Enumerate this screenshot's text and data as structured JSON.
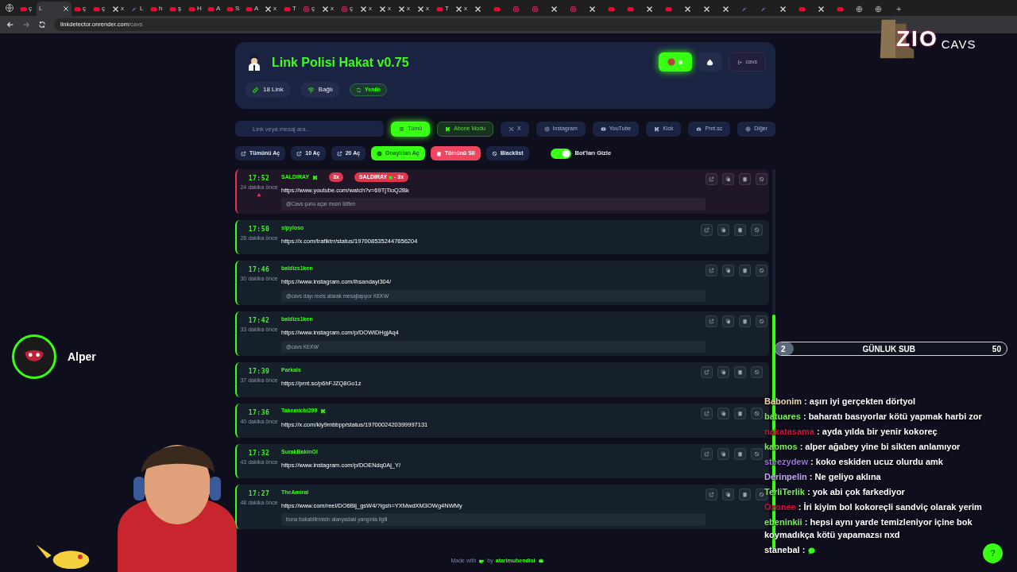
{
  "browser": {
    "tabs": [
      {
        "kind": "youtube",
        "label": "ç",
        "selected": false
      },
      {
        "kind": "plain",
        "label": "L",
        "selected": true
      },
      {
        "kind": "youtube",
        "label": "ç",
        "selected": false
      },
      {
        "kind": "youtube",
        "label": "ç",
        "selected": false
      },
      {
        "kind": "x",
        "label": "x",
        "selected": false
      },
      {
        "kind": "feather",
        "label": "L",
        "selected": false
      },
      {
        "kind": "youtube",
        "label": "h",
        "selected": false
      },
      {
        "kind": "youtube",
        "label": "ş",
        "selected": false
      },
      {
        "kind": "youtube",
        "label": "H",
        "selected": false
      },
      {
        "kind": "youtube",
        "label": "A",
        "selected": false
      },
      {
        "kind": "youtube",
        "label": "S",
        "selected": false
      },
      {
        "kind": "youtube",
        "label": "A",
        "selected": false
      },
      {
        "kind": "x",
        "label": "x",
        "selected": false
      },
      {
        "kind": "youtube",
        "label": "T",
        "selected": false
      },
      {
        "kind": "instagram",
        "label": "ç",
        "selected": false
      },
      {
        "kind": "x",
        "label": "x",
        "selected": false
      },
      {
        "kind": "instagram",
        "label": "ç",
        "selected": false
      },
      {
        "kind": "x",
        "label": "x",
        "selected": false
      },
      {
        "kind": "x",
        "label": "x",
        "selected": false
      },
      {
        "kind": "x",
        "label": "x",
        "selected": false
      },
      {
        "kind": "x",
        "label": "x",
        "selected": false
      },
      {
        "kind": "youtube",
        "label": "T",
        "selected": false
      },
      {
        "kind": "x",
        "label": "x",
        "selected": false
      },
      {
        "kind": "x",
        "selected": false
      },
      {
        "kind": "youtube",
        "selected": false
      },
      {
        "kind": "instagram",
        "selected": false
      },
      {
        "kind": "instagram",
        "selected": false
      },
      {
        "kind": "x",
        "selected": false
      },
      {
        "kind": "instagram",
        "selected": false
      },
      {
        "kind": "x",
        "selected": false
      },
      {
        "kind": "youtube",
        "selected": false
      },
      {
        "kind": "youtube",
        "selected": false
      },
      {
        "kind": "x",
        "selected": false
      },
      {
        "kind": "youtube",
        "selected": false
      },
      {
        "kind": "x",
        "selected": false
      },
      {
        "kind": "x",
        "selected": false
      },
      {
        "kind": "x",
        "selected": false
      },
      {
        "kind": "feather",
        "selected": false
      },
      {
        "kind": "feather",
        "selected": false
      },
      {
        "kind": "x",
        "selected": false
      },
      {
        "kind": "youtube",
        "selected": false
      },
      {
        "kind": "x",
        "selected": false
      },
      {
        "kind": "youtube",
        "selected": false
      },
      {
        "kind": "globe",
        "selected": false
      },
      {
        "kind": "globe",
        "selected": false
      }
    ],
    "new_tab_label": "+",
    "url_host": "linkdetector.onrender.com",
    "url_path": "/cavs"
  },
  "app": {
    "title": "Link Polisi Hakat v0.75",
    "stats": [
      {
        "kind": "link",
        "label": "18 Link"
      },
      {
        "kind": "wifi",
        "label": "Bağlı"
      },
      {
        "kind": "refresh",
        "label": "Yenile"
      }
    ],
    "logout_label": "cavs",
    "search": {
      "placeholder": "Link veya mesaj ara..."
    },
    "filters": [
      {
        "kind": "list",
        "label": "Tümü",
        "selected": true
      },
      {
        "kind": "kick",
        "label": "Abone Modu",
        "selected": false
      },
      {
        "kind": "x",
        "label": "X",
        "selected": false
      },
      {
        "kind": "instagram",
        "label": "Instagram",
        "selected": false
      },
      {
        "kind": "youtube",
        "label": "YouTube",
        "selected": false
      },
      {
        "kind": "kick",
        "label": "Kick",
        "selected": false
      },
      {
        "kind": "camera",
        "label": "Prnt.sc",
        "selected": false
      },
      {
        "kind": "globe",
        "label": "Diğer",
        "selected": false
      }
    ],
    "actions": [
      {
        "kind": "plain",
        "label": "Tümünü Aç"
      },
      {
        "kind": "plain",
        "label": "10 Aç"
      },
      {
        "kind": "plain",
        "label": "20 Aç"
      },
      {
        "kind": "success",
        "label": "Onaylıları Aç"
      },
      {
        "kind": "danger",
        "label": "Tümünü Sil"
      },
      {
        "kind": "block",
        "label": "Blacklist"
      }
    ],
    "bot_toggle": {
      "label": "Bot'ları Gizle",
      "on": true
    },
    "links": [
      {
        "time": "17:52",
        "ago": "24 dakika önce",
        "user": "SALDIRAY",
        "subscriber": true,
        "flagged": true,
        "badges": [
          {
            "kind": "count",
            "label": "3x"
          },
          {
            "kind": "user",
            "label": "SALDIRAY",
            "suffix": "- 3x"
          }
        ],
        "url": "https://www.youtube.com/watch?v=69TjTioQ2Bk",
        "message": "@Cavs şunu açar mısın lütfen"
      },
      {
        "time": "17:50",
        "ago": "28 dakika önce",
        "user": "sipyloso",
        "subscriber": false,
        "flagged": false,
        "url": "https://x.com/trafiktrr/status/1970085352447656204"
      },
      {
        "time": "17:46",
        "ago": "30 dakika önce",
        "user": "baldizs1ken",
        "subscriber": false,
        "flagged": false,
        "url": "https://www.instagram.com/ihsandayi304/",
        "message": "@cavs dayı reels atarak mesajlaşıyor KEKW"
      },
      {
        "time": "17:42",
        "ago": "33 dakika önce",
        "user": "baldizs1ken",
        "subscriber": false,
        "flagged": false,
        "url": "https://www.instagram.com/p/DOWiDHgjAq4",
        "message": "@cavs KEKW"
      },
      {
        "time": "17:39",
        "ago": "37 dakika önce",
        "user": "Parkals",
        "subscriber": false,
        "flagged": false,
        "url": "https://prnt.sc/p6hFJZQ8Go1z"
      },
      {
        "time": "17:36",
        "ago": "40 dakika önce",
        "user": "Takemichi299",
        "subscriber": true,
        "flagged": false,
        "url": "https://x.com/kly9mbbpp/status/1970002420399997131"
      },
      {
        "time": "17:32",
        "ago": "43 dakika önce",
        "user": "SurakBakinOl",
        "subscriber": false,
        "flagged": false,
        "url": "https://www.instagram.com/p/DOENdq0Aj_Y/"
      },
      {
        "time": "17:27",
        "ago": "48 dakika önce",
        "user": "TheAmiral",
        "subscriber": false,
        "flagged": false,
        "url": "https://www.com/reel/DO6Bij_gsW4/?igsh=YXMwdXM3OWg4NWMy",
        "message": "buna bakabilirmisin alanyadaki yangınla ilgili"
      }
    ],
    "footer": {
      "prefix": "Made with",
      "middle": "by",
      "author": "atarimuhendisi"
    }
  },
  "overlay": {
    "logo": {
      "top": "ZIO",
      "bottom": "CAVS"
    },
    "webcam_name": "Alper",
    "sub_goal": {
      "current": "2",
      "label": "GÜNLUK SUB",
      "target": "50",
      "level": 0.04
    },
    "chat": [
      {
        "user": "Babonim",
        "color": "#f0d7a8",
        "message": ": aşırı iyi gerçekten dörtyol"
      },
      {
        "user": "batuares",
        "color": "#7cf05a",
        "message": ": baharatı basıyorlar kötü yapmak harbi zor"
      },
      {
        "user": "nakatasama",
        "color": "#d0103a",
        "message": ": ayda yılda bir yenir kokoreç"
      },
      {
        "user": "kaomos",
        "color": "#7cf05a",
        "message": ": alper ağabey yine bi sikten anlamıyor"
      },
      {
        "user": "steezydew",
        "color": "#a070e0",
        "message": ": koko eskiden ucuz olurdu amk"
      },
      {
        "user": "Derinpelin",
        "color": "#c0a8f0",
        "message": ": Ne geliyo aklına"
      },
      {
        "user": "TerliTerlik",
        "color": "#7cf05a",
        "message": ": yok abi çok farkediyor"
      },
      {
        "user": "Ozonee",
        "color": "#d0103a",
        "message": ": İri kiyim bol kokoreçli sandviç olarak yerim"
      },
      {
        "user": "ebeninkii",
        "color": "#7cf05a",
        "message": ": hepsi aynı yarde temizleniyor içine bok koymadıkça kötü yapamazsı nxd"
      },
      {
        "user": "stanebal",
        "color": "#ffffff",
        "message": ":",
        "emote": true
      }
    ],
    "help": "?"
  }
}
